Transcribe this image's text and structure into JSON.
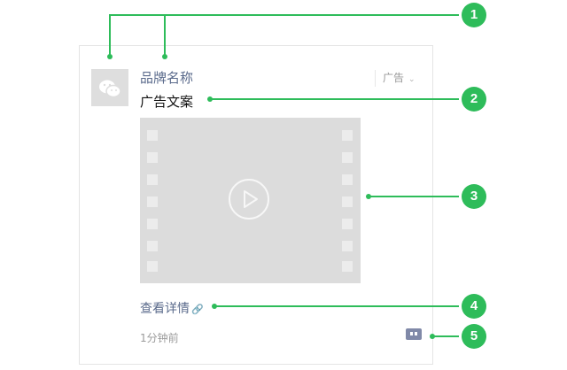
{
  "card": {
    "brand_name": "品牌名称",
    "ad_label": "广告",
    "ad_copy": "广告文案",
    "detail_link": "查看详情",
    "timestamp": "1分钟前"
  },
  "callouts": [
    {
      "number": "1"
    },
    {
      "number": "2"
    },
    {
      "number": "3"
    },
    {
      "number": "4"
    },
    {
      "number": "5"
    }
  ],
  "colors": {
    "callout_green": "#2ebc5a",
    "link_blue_gray": "#5b6b8c",
    "placeholder_gray": "#dcdcdc"
  },
  "icons": {
    "avatar": "wechat-logo-icon",
    "ad_dropdown": "chevron-down-icon",
    "video": "play-icon",
    "detail": "link-icon",
    "feedback": "robot-icon"
  }
}
